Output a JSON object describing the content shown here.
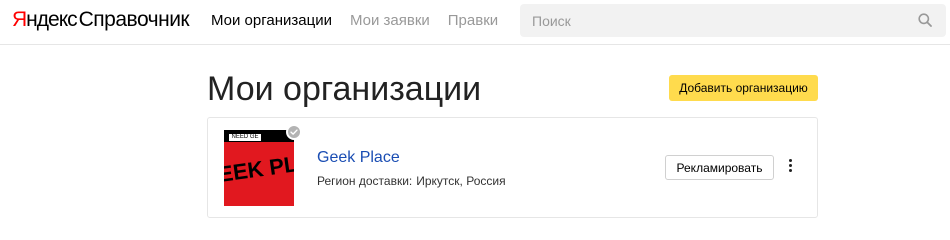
{
  "header": {
    "logo": {
      "brand_first": "Я",
      "brand_rest": "ндекс",
      "product": "Справочник"
    },
    "nav": [
      {
        "label": "Мои организации",
        "active": true
      },
      {
        "label": "Мои заявки",
        "active": false
      },
      {
        "label": "Правки",
        "active": false
      }
    ],
    "search": {
      "placeholder": "Поиск",
      "value": "",
      "icon": "search-icon"
    }
  },
  "main": {
    "title": "Мои организации",
    "add_button_label": "Добавить организацию",
    "organizations": [
      {
        "name": "Geek Place",
        "region_label": "Регион доставки:",
        "region_value": "Иркутск, Россия",
        "logo_tag": "NEED GE",
        "logo_art": "EEK PLACI",
        "promote_button_label": "Рекламировать",
        "more_icon": "more-vertical-icon",
        "verified_icon": "verified-badge-icon"
      }
    ]
  },
  "colors": {
    "accent_button": "#ffdb4d",
    "link": "#1a4db3",
    "logo_red": "#ff0000"
  }
}
